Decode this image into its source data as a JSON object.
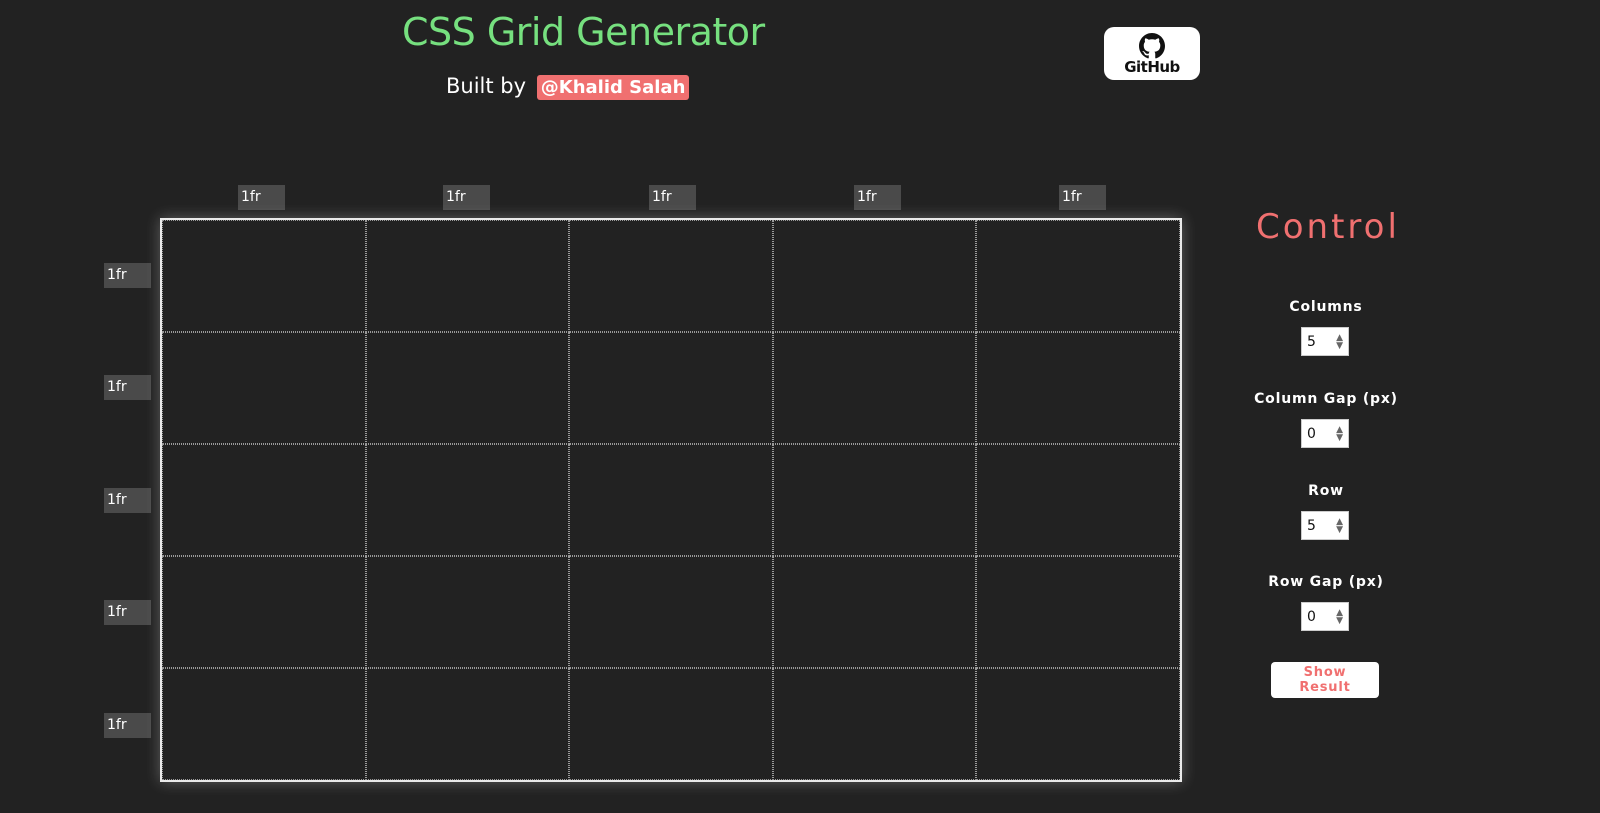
{
  "header": {
    "title": "CSS Grid Generator",
    "built_by": "Built by",
    "author": "@Khalid Salah",
    "github_label": "GitHub"
  },
  "grid": {
    "column_sizes": [
      "1fr",
      "1fr",
      "1fr",
      "1fr",
      "1fr"
    ],
    "row_sizes": [
      "1fr",
      "1fr",
      "1fr",
      "1fr",
      "1fr"
    ]
  },
  "control": {
    "title": "Control",
    "columns_label": "Columns",
    "columns_value": "5",
    "column_gap_label": "Column Gap (px)",
    "column_gap_value": "0",
    "row_label": "Row",
    "row_value": "5",
    "row_gap_label": "Row Gap (px)",
    "row_gap_value": "0",
    "show_result": "Show Result"
  },
  "colors": {
    "background": "#222222",
    "title_green": "#76e07f",
    "accent_red": "#f07070",
    "size_box": "#4a4a4a"
  },
  "icons": {
    "github": "github-icon"
  }
}
